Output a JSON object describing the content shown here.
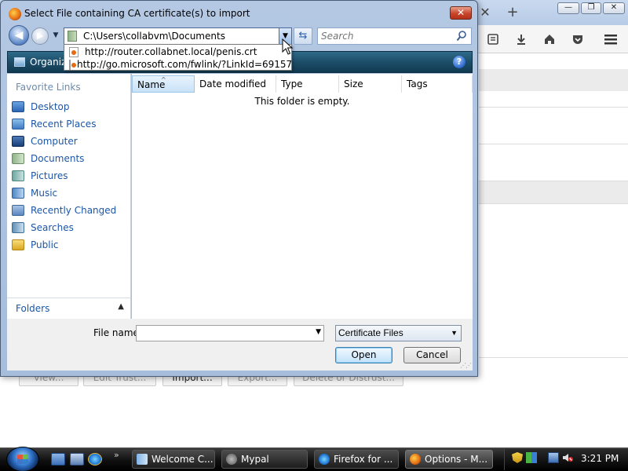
{
  "dialog": {
    "title": "Select File containing CA certificate(s) to import",
    "close_label": "✕",
    "address": "C:\\Users\\collabvm\\Documents",
    "address_suggestions": [
      "http://router.collabnet.local/penis.crt",
      "http://go.microsoft.com/fwlink/?LinkId=69157"
    ],
    "search_placeholder": "Search",
    "toolbar": {
      "organize_label": "Organiz",
      "help_label": "?"
    },
    "favorite_links_heading": "Favorite Links",
    "favorite_links": [
      {
        "label": "Desktop",
        "icon": "desktop-icon"
      },
      {
        "label": "Recent Places",
        "icon": "recent-places-icon"
      },
      {
        "label": "Computer",
        "icon": "computer-icon"
      },
      {
        "label": "Documents",
        "icon": "documents-icon"
      },
      {
        "label": "Pictures",
        "icon": "pictures-icon"
      },
      {
        "label": "Music",
        "icon": "music-icon"
      },
      {
        "label": "Recently Changed",
        "icon": "recently-changed-icon"
      },
      {
        "label": "Searches",
        "icon": "searches-icon"
      },
      {
        "label": "Public",
        "icon": "public-folder-icon"
      }
    ],
    "folders_label": "Folders",
    "columns": [
      "Name",
      "Date modified",
      "Type",
      "Size",
      "Tags"
    ],
    "empty_message": "This folder is empty.",
    "file_name_label": "File name:",
    "file_name_value": "",
    "file_type": "Certificate Files",
    "open_label": "Open",
    "cancel_label": "Cancel"
  },
  "background": {
    "buttons": [
      "View...",
      "Edit Trust...",
      "Import...",
      "Export...",
      "Delete or Distrust..."
    ],
    "new_tab_label": "+",
    "close_tab_label": "✕"
  },
  "taskbar": {
    "tasks": [
      {
        "label": "Welcome C...",
        "icon": "document-icon",
        "active": false
      },
      {
        "label": "Mypal",
        "icon": "mypal-icon",
        "active": false
      },
      {
        "label": "Firefox for ...",
        "icon": "ie-icon",
        "active": false
      },
      {
        "label": "Options - M...",
        "icon": "firefox-icon",
        "active": true
      }
    ],
    "clock": "3:21 PM"
  },
  "colors": {
    "link_blue": "#1b56a7",
    "toolbar_dark_teal": "#1d4d68",
    "title_bar": "#b4c8e3",
    "close_red": "#c8452a"
  }
}
